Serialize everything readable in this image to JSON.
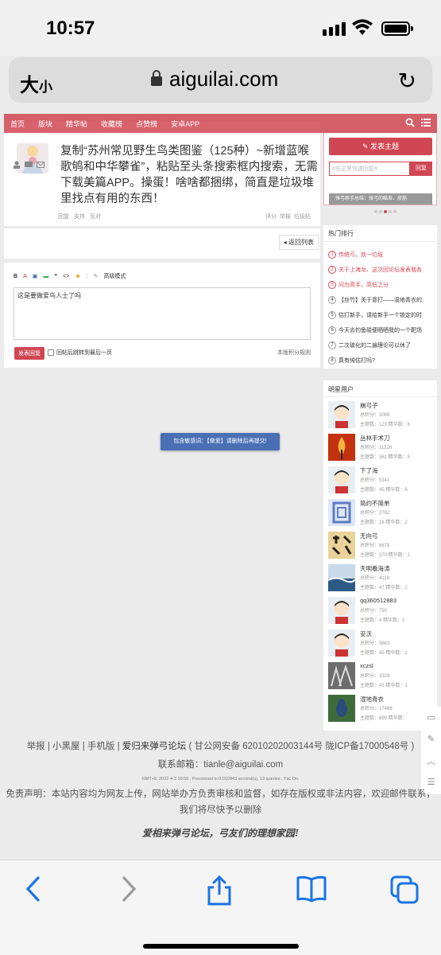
{
  "status": {
    "time": "10:57"
  },
  "browser": {
    "text_size": "大",
    "text_size_small": "小",
    "url": "aiguilai.com"
  },
  "nav": {
    "items": [
      "首页",
      "版块",
      "精华帖",
      "收藏榜",
      "点赞榜",
      "安卓APP"
    ]
  },
  "thread": {
    "title": "复制“苏州常见野生鸟类图鉴（125种）~新增蓝喉歌鸲和中华攀雀”，粘贴至头条搜索框内搜索，无需下载美篇APP。操蛋！啥啥都捆绑，简直是垃圾堆里找点有用的东西！",
    "actions_left": [
      "回复",
      "支持",
      "反对"
    ],
    "actions_right": [
      "评分",
      "举报",
      "垃圾帖"
    ],
    "back_label": "返回列表"
  },
  "editor": {
    "advanced_label": "高级模式",
    "content": "这是要做爱鸟人士了吗",
    "submit_label": "发表回复",
    "checkbox_label": "回帖后跳转到最后一页",
    "rules_label": "本版积分规则"
  },
  "toast": {
    "message": "包含敏感词：【做爱】请删除后再提交!"
  },
  "sidebar": {
    "new_topic_label": "发表主题",
    "search_placeholder": "#在这里快速回复#",
    "reply_label": "回复",
    "banner_text": "弹弓新手总结：弹弓的瞄准、皮筋",
    "hot_title": "热门排行",
    "hot_items": [
      {
        "n": "1",
        "text": "传统弓，就一垃圾"
      },
      {
        "n": "2",
        "text": "关于上海龙、这次回论坛发表我各"
      },
      {
        "n": "3",
        "text": "问为高手，高低之分"
      },
      {
        "n": "4",
        "text": "【丝竹】关于意打——湿地青衣的"
      },
      {
        "n": "5",
        "text": "估打新手，请给新手一个锁定的时"
      },
      {
        "n": "6",
        "text": "今天去钓鱼碰便晒晒我的一个靶场"
      },
      {
        "n": "7",
        "text": "二次硫化的二遍理论可以休了"
      },
      {
        "n": "8",
        "text": "真有纯估打吗?"
      }
    ],
    "stars_title": "明星用户",
    "stars": [
      {
        "name": "崩弓子",
        "total": "总积分：3088",
        "stats": "主题数：123    精华数：6"
      },
      {
        "name": "丛林手术刀",
        "total": "总积分：11226",
        "stats": "主题数：361    精华数：5"
      },
      {
        "name": "下了海",
        "total": "总积分：5341",
        "stats": "主题数：45    精华数：8"
      },
      {
        "name": "简约不简单",
        "total": "总积分：2762",
        "stats": "主题数：18    精华数：2"
      },
      {
        "name": "无向弓",
        "total": "总积分：6678",
        "stats": "主题数：170    精华数：2"
      },
      {
        "name": "天明看海涛",
        "total": "总积分：4118",
        "stats": "主题数：47    精华数：2"
      },
      {
        "name": "qq360512883",
        "total": "总积分：790",
        "stats": "主题数：4    精华数：2"
      },
      {
        "name": "妥沃",
        "total": "总积分：3663",
        "stats": "主题数：45    精华数：2"
      },
      {
        "name": "xczsl",
        "total": "总积分：3329",
        "stats": "主题数：45    精华数：1"
      },
      {
        "name": "湿地青衣",
        "total": "总积分：17488",
        "stats": "主题数：699    精华数："
      }
    ]
  },
  "footer": {
    "links": "举报 | 小黑屋 | 手机版 |",
    "site_name": "爱归来弹弓论坛",
    "icp": "( 甘公网安备 62010202003144号    陇ICP备17000548号 )",
    "email": "联系邮箱：tianle@aiguilai.com",
    "gmt": "GMT+8, 2022-4-3 10:56 , Processed in 0.010943 second(s), 13 queries , Yac On.",
    "disclaimer": "免责声明：本站内容均为网友上传，网站举办方负责审核和监督，如存在版权或非法内容，欢迎邮件联系，我们将尽快予以删除",
    "slogan": "爱相来弹弓论坛，弓友们的理想家园!"
  }
}
